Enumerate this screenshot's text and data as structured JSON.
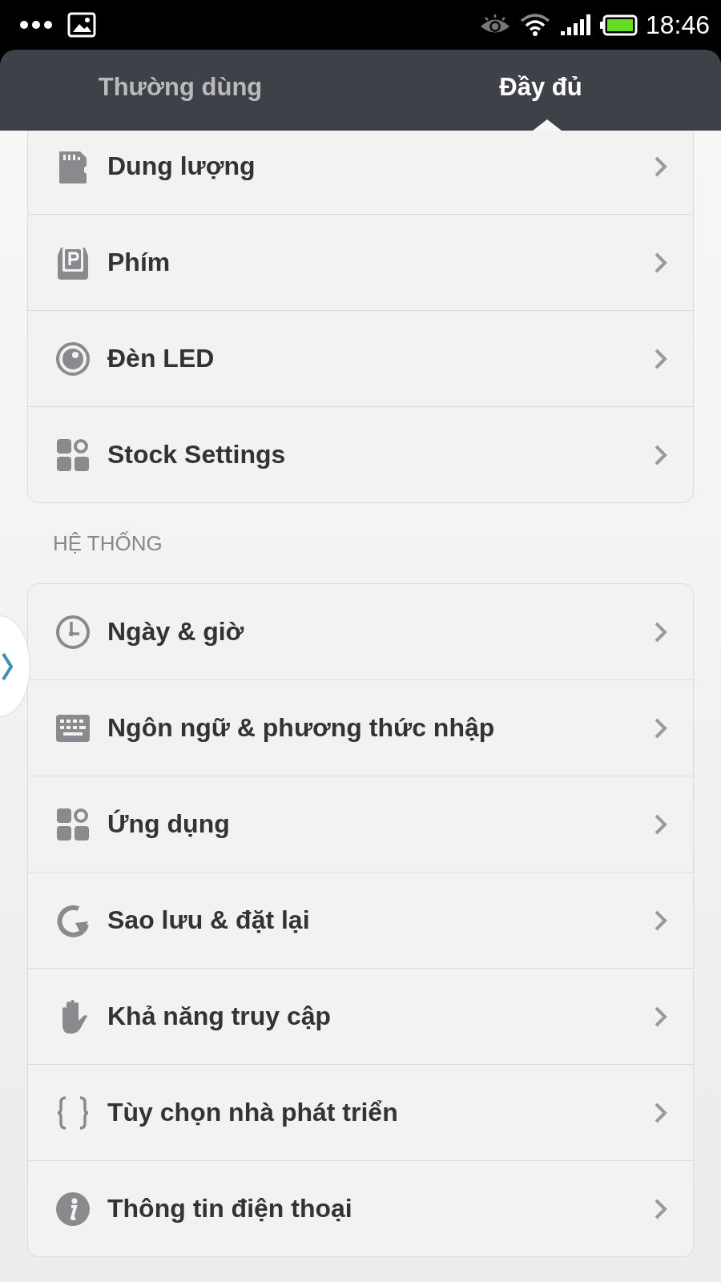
{
  "status_bar": {
    "time": "18:46"
  },
  "tabs": [
    {
      "label": "Thường dùng",
      "selected": false
    },
    {
      "label": "Đầy đủ",
      "selected": true
    }
  ],
  "groups": [
    {
      "rows": [
        {
          "label": "Dung lượng"
        },
        {
          "label": "Phím"
        },
        {
          "label": "Đèn LED"
        },
        {
          "label": "Stock Settings"
        }
      ]
    },
    {
      "header": "HỆ THỐNG",
      "rows": [
        {
          "label": "Ngày & giờ"
        },
        {
          "label": "Ngôn ngữ & phương thức nhập"
        },
        {
          "label": "Ứng dụng"
        },
        {
          "label": "Sao lưu & đặt lại"
        },
        {
          "label": "Khả năng truy cập"
        },
        {
          "label": "Tùy chọn nhà phát triển"
        },
        {
          "label": "Thông tin điện thoại"
        }
      ]
    }
  ]
}
